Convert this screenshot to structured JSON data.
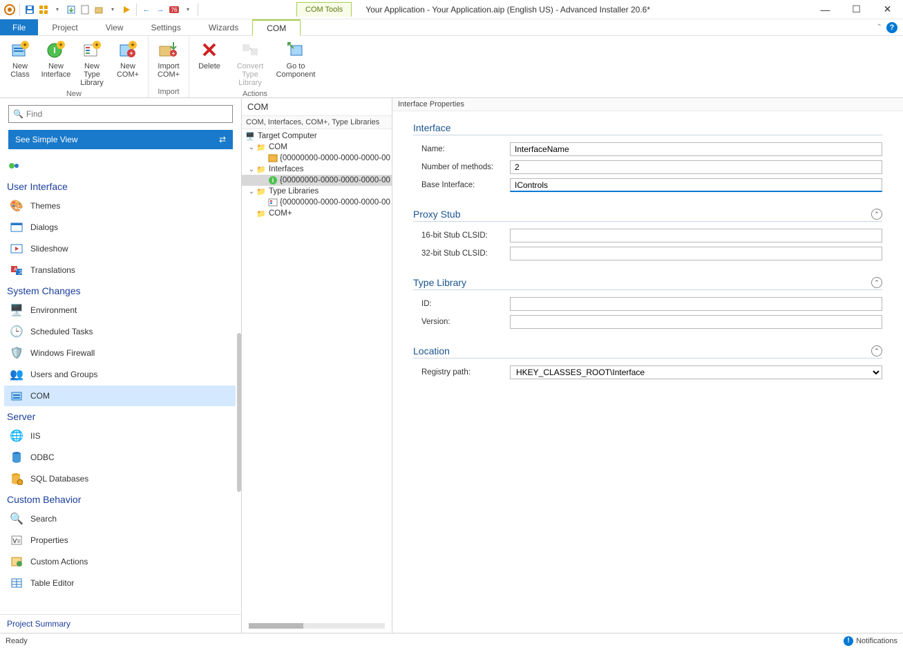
{
  "title": "Your Application - Your Application.aip (English US) - Advanced Installer 20.6*",
  "com_tools_tab": "COM Tools",
  "menu": {
    "file": "File",
    "project": "Project",
    "view": "View",
    "settings": "Settings",
    "wizards": "Wizards",
    "com": "COM"
  },
  "ribbon": {
    "new_class": "New\nClass",
    "new_interface": "New\nInterface",
    "new_type_library": "New Type\nLibrary",
    "new_com_plus": "New\nCOM+",
    "import_com_plus": "Import\nCOM+",
    "delete": "Delete",
    "convert_type_library": "Convert\nType Library",
    "go_to_component": "Go to\nComponent",
    "group_new": "New",
    "group_import": "Import",
    "group_actions": "Actions"
  },
  "find_placeholder": "Find",
  "simple_view": "See Simple View",
  "nav": {
    "cat_ui": "User Interface",
    "themes": "Themes",
    "dialogs": "Dialogs",
    "slideshow": "Slideshow",
    "translations": "Translations",
    "cat_system": "System Changes",
    "environment": "Environment",
    "scheduled_tasks": "Scheduled Tasks",
    "windows_firewall": "Windows Firewall",
    "users_groups": "Users and Groups",
    "com": "COM",
    "cat_server": "Server",
    "iis": "IIS",
    "odbc": "ODBC",
    "sql": "SQL Databases",
    "cat_custom": "Custom Behavior",
    "search": "Search",
    "properties": "Properties",
    "custom_actions": "Custom Actions",
    "table_editor": "Table Editor"
  },
  "project_summary": "Project Summary",
  "center": {
    "header": "COM",
    "subheader": "COM, Interfaces, COM+, Type Libraries",
    "target_computer": "Target Computer",
    "com_node": "COM",
    "com_guid": "{00000000-0000-0000-0000-00",
    "interfaces_node": "Interfaces",
    "interfaces_guid": "{00000000-0000-0000-0000-00",
    "type_libraries_node": "Type Libraries",
    "type_libraries_guid": "{00000000-0000-0000-0000-00",
    "com_plus_node": "COM+"
  },
  "right_header": "Interface Properties",
  "sections": {
    "interface": "Interface",
    "proxy_stub": "Proxy Stub",
    "type_library": "Type Library",
    "location": "Location"
  },
  "fields": {
    "name_label": "Name:",
    "name_value": "InterfaceName",
    "num_methods_label": "Number of methods:",
    "num_methods_value": "2",
    "base_interface_label": "Base Interface:",
    "base_interface_value": "IControls",
    "stub16_label": "16-bit Stub CLSID:",
    "stub16_value": "",
    "stub32_label": "32-bit Stub CLSID:",
    "stub32_value": "",
    "tl_id_label": "ID:",
    "tl_id_value": "",
    "tl_version_label": "Version:",
    "tl_version_value": "",
    "registry_label": "Registry path:",
    "registry_value": "HKEY_CLASSES_ROOT\\Interface"
  },
  "status": {
    "ready": "Ready",
    "notifications": "Notifications"
  }
}
